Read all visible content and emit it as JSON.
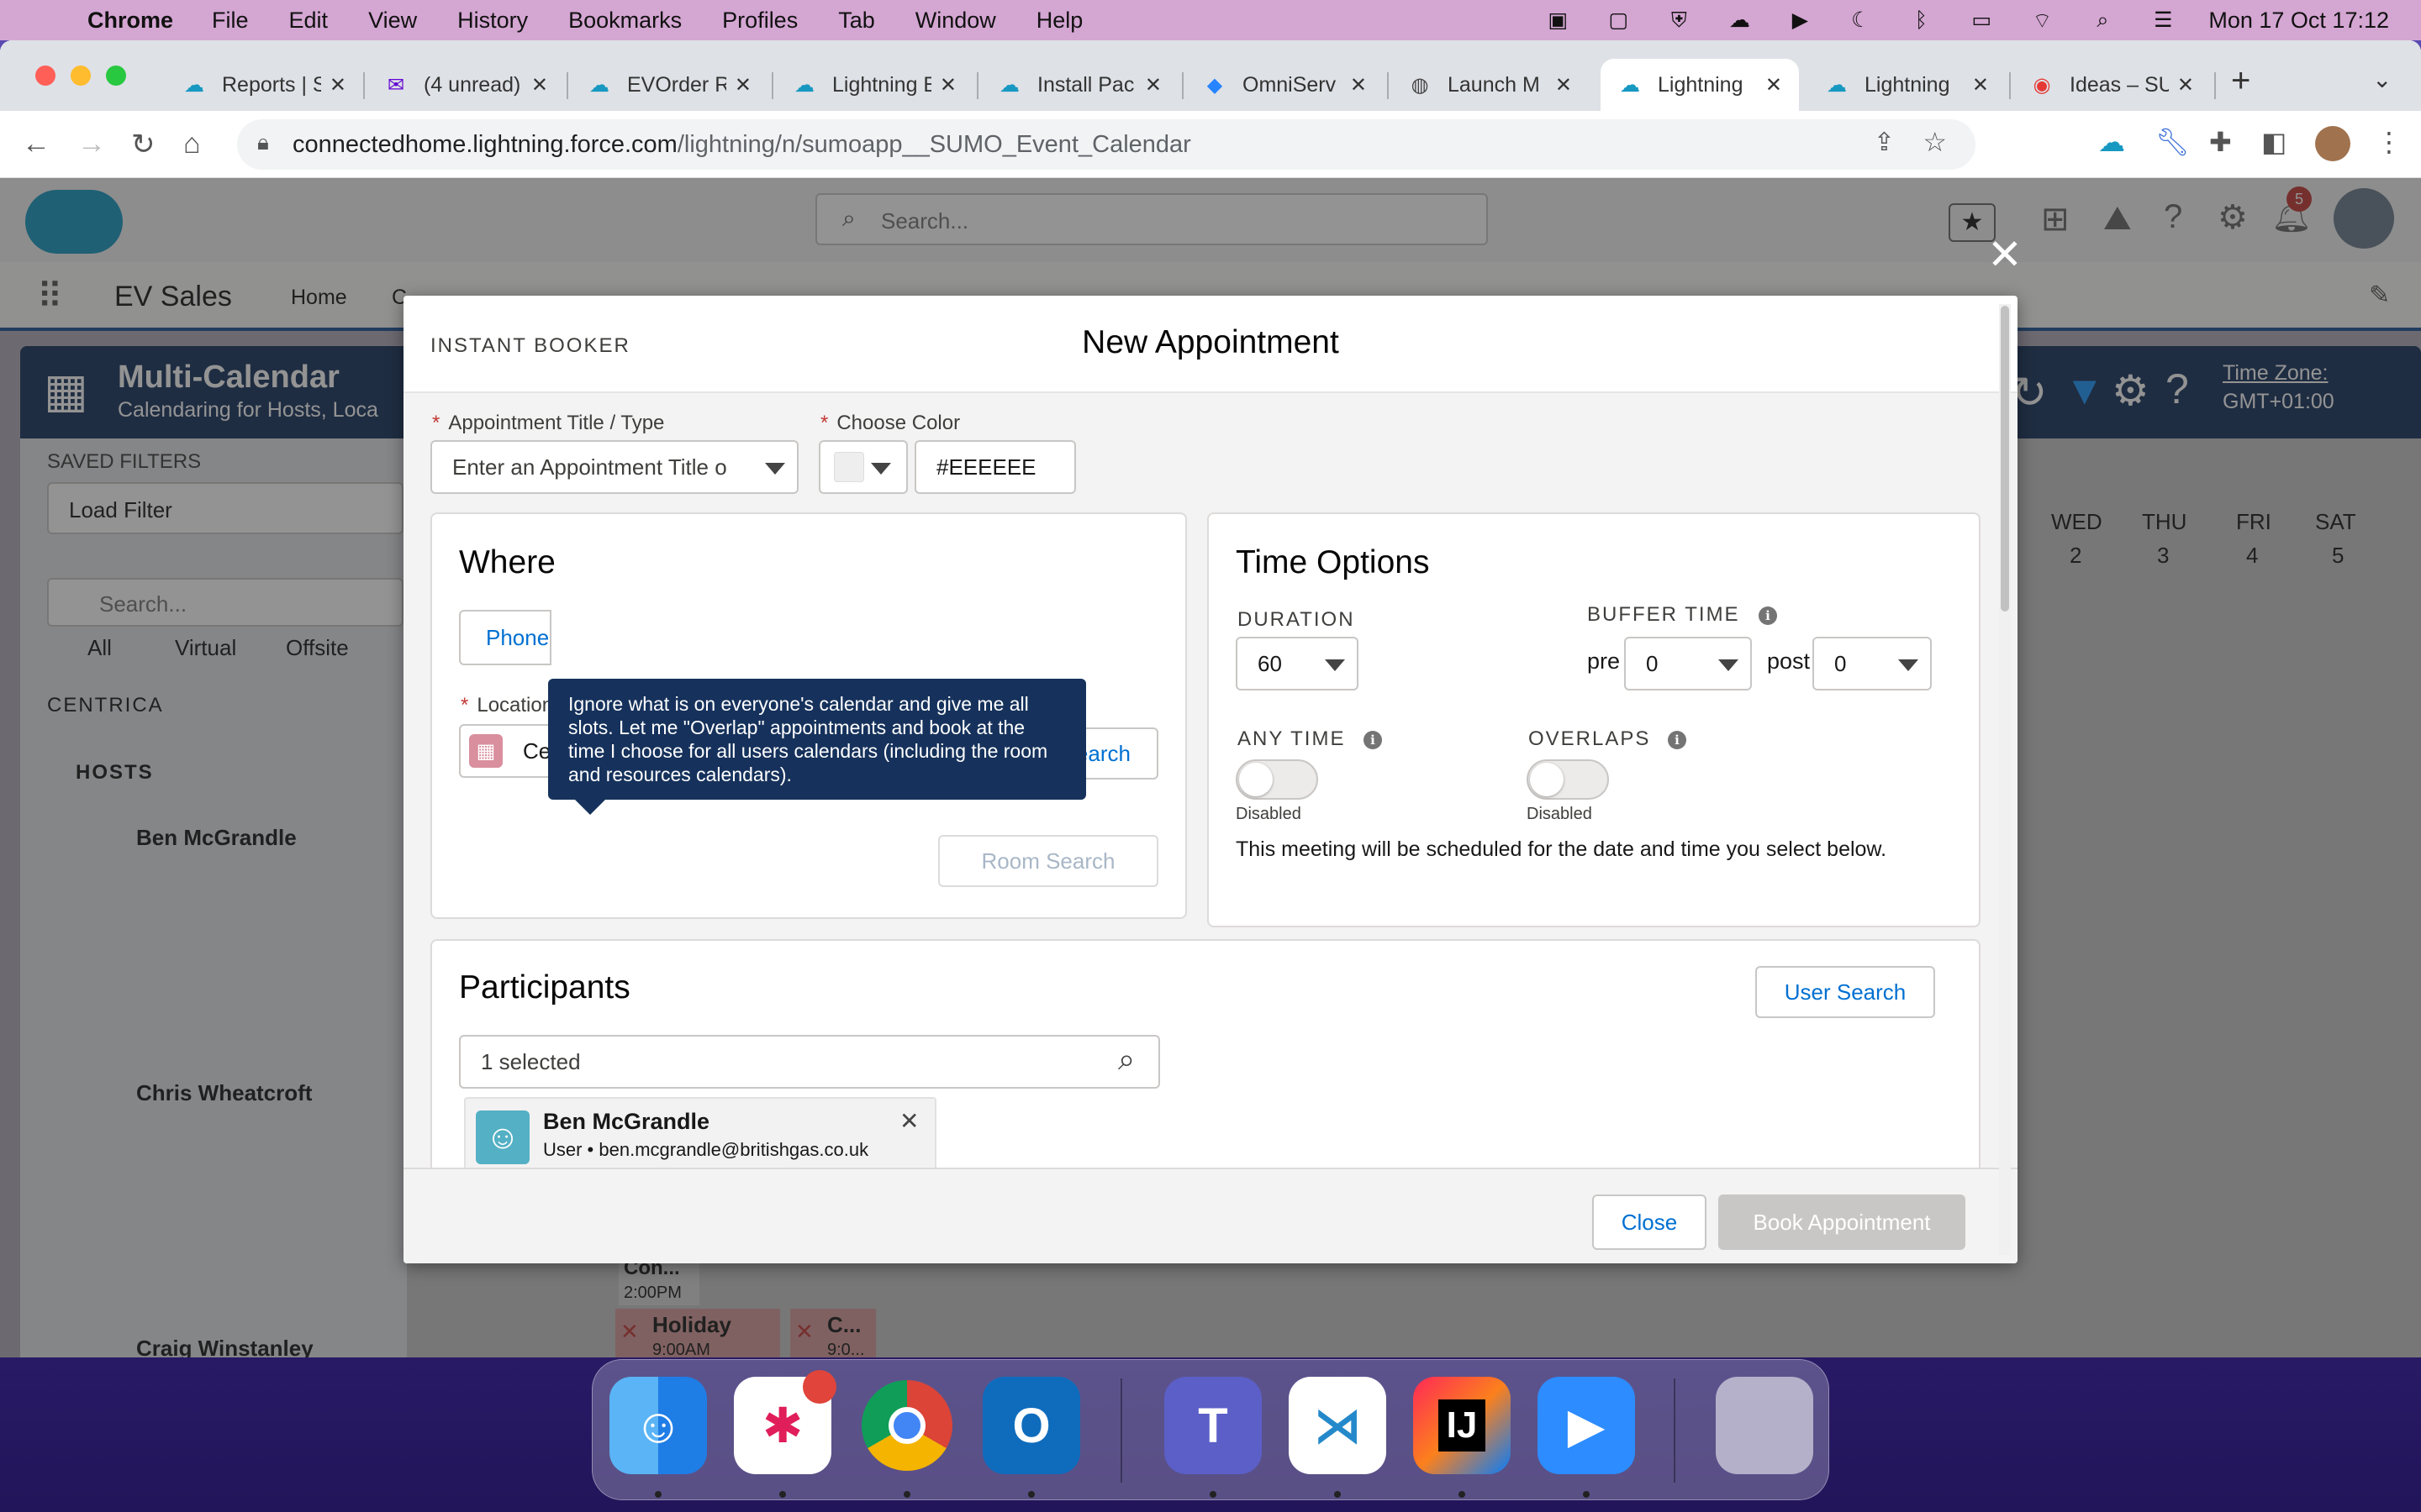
{
  "menubar": {
    "app": "Chrome",
    "items": [
      "File",
      "Edit",
      "View",
      "History",
      "Bookmarks",
      "Profiles",
      "Tab",
      "Window",
      "Help"
    ],
    "datetime": "Mon 17 Oct  17:12"
  },
  "browser": {
    "tabs": [
      {
        "title": "Reports | S"
      },
      {
        "title": "(4 unread)"
      },
      {
        "title": "EVOrder R"
      },
      {
        "title": "Lightning E"
      },
      {
        "title": "Install Pac"
      },
      {
        "title": "OmniServ"
      },
      {
        "title": "Launch M"
      },
      {
        "title": "Lightning"
      },
      {
        "title": "Lightning"
      },
      {
        "title": "Ideas – SU"
      }
    ],
    "url_host": "connectedhome.lightning.force.com",
    "url_path": "/lightning/n/sumoapp__SUMO_Event_Calendar"
  },
  "sf": {
    "search_placeholder": "Search...",
    "app_name": "EV Sales",
    "nav_home": "Home",
    "nav_cut": "C",
    "page_title": "Multi-Calendar",
    "page_subtitle": "Calendaring for Hosts, Loca",
    "timezone_label": "Time Zone:",
    "timezone_value": "GMT+01:00",
    "saved_filters": "SAVED FILTERS",
    "load_filter": "Load Filter",
    "left_search": "Search...",
    "radio_all": "All",
    "radio_virtual": "Virtual",
    "radio_offsite": "Offsite",
    "group": "CENTRICA",
    "hosts_label": "HOSTS",
    "hosts": [
      "Ben McGrandle",
      "Chris Wheatcroft",
      "Craig Winstanley"
    ],
    "days": [
      {
        "dow": "WED",
        "num": "2"
      },
      {
        "dow": "THU",
        "num": "3"
      },
      {
        "dow": "FRI",
        "num": "4"
      },
      {
        "dow": "SAT",
        "num": "5"
      }
    ],
    "events": [
      {
        "title": "Con...",
        "time": "2:00PM"
      },
      {
        "title": "Holiday",
        "time": "9:00AM"
      },
      {
        "title": "C...",
        "time": "9:0..."
      }
    ],
    "notification_count": "5"
  },
  "modal": {
    "header_label": "INSTANT BOOKER",
    "title": "New Appointment",
    "appt_label": "Appointment Title / Type",
    "appt_placeholder": "Enter an Appointment Title o",
    "color_label": "Choose Color",
    "color_hex": "#EEEEEE",
    "where_title": "Where",
    "phone_tab": "Phone",
    "tooltip": "Ignore what is on everyone's calendar and give me all slots. Let me \"Overlap\" appointments and book at the time I choose for all users calendars (including the room and resources calendars).",
    "location_label": "Location",
    "location_value": "Centrica",
    "location_search": "Location Search",
    "room_search": "Room Search",
    "time_title": "Time Options",
    "duration_label": "DURATION",
    "duration_value": "60",
    "buffer_label": "BUFFER TIME",
    "pre_label": "pre",
    "pre_value": "0",
    "post_label": "post",
    "post_value": "0",
    "anytime_label": "ANY TIME",
    "anytime_state": "Disabled",
    "overlaps_label": "OVERLAPS",
    "overlaps_state": "Disabled",
    "schedule_note": "This meeting will be scheduled for the date and time you select below.",
    "participants_title": "Participants",
    "user_search": "User Search",
    "selected_text": "1 selected",
    "participant_name": "Ben McGrandle",
    "participant_sub": "User • ben.mcgrandle@britishgas.co.uk",
    "close_btn": "Close",
    "book_btn": "Book Appointment"
  },
  "dock": {
    "apps": [
      "finder-icon",
      "slack-icon",
      "chrome-icon",
      "outlook-icon",
      "teams-icon",
      "vscode-icon",
      "intellij-icon",
      "zoom-icon",
      "trash-icon"
    ]
  },
  "colors": {
    "sf_blue": "#0070d2",
    "navy": "#16325c",
    "required": "#c23934",
    "menubar": "#d4a6d2"
  }
}
